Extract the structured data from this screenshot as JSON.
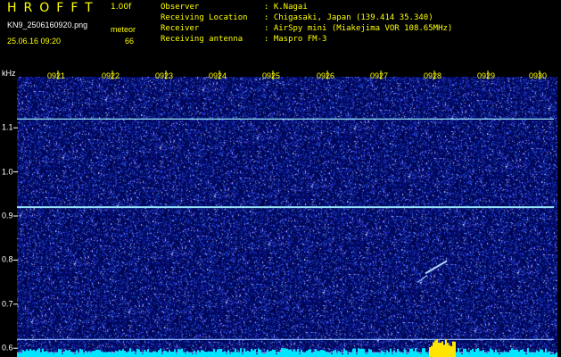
{
  "header": {
    "app_title": "HROFFT",
    "version": "1.00f",
    "filename": "KN9_2506160920.png",
    "meteor_label": "meteor",
    "datetime": "25.06.16 09:20",
    "meteor_count": "66"
  },
  "info": [
    {
      "key": "Observer",
      "value": ": K.Nagai"
    },
    {
      "key": "Receiving Location",
      "value": ": Chigasaki, Japan (139.414 35.340)"
    },
    {
      "key": "Receiver",
      "value": ": AirSpy mini (Miakejima VOR 108.65MHz)"
    },
    {
      "key": "Receiving antenna",
      "value": ": Maspro FM-3"
    }
  ],
  "spectrogram": {
    "unit": "kHz",
    "time_labels": [
      "0921",
      "0922",
      "0923",
      "0924",
      "0925",
      "0926",
      "0927",
      "0928",
      "0929",
      "0930"
    ],
    "time_start_min": 20,
    "time_end_min": 30,
    "freq_labels": [
      "1.1",
      "1.0",
      "0.9",
      "0.8",
      "0.7",
      "0.6"
    ],
    "freq_top_khz": 1.2,
    "freq_bottom_khz": 0.58,
    "carriers_khz": [
      1.12,
      0.92,
      0.62,
      0.59
    ],
    "meteor_echo": {
      "time_min": 28.1,
      "freq_khz": 0.79
    },
    "colors": {
      "background": "#000000",
      "noise_dark": "#000a5a",
      "noise_bright": "#3c5aff",
      "carrier": "#9ff0ff",
      "baseline": "#00e6ff",
      "text": "#ffff00"
    }
  }
}
